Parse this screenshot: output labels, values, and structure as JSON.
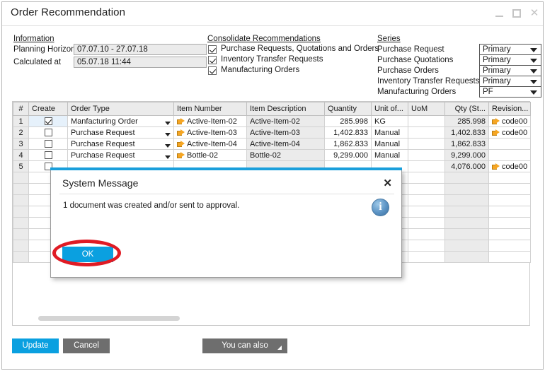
{
  "window": {
    "title": "Order Recommendation",
    "minimize_label": "minimize",
    "maximize_label": "maximize",
    "close_label": "close"
  },
  "information": {
    "group_title": "Information",
    "fields": [
      {
        "label": "Planning Horizon",
        "value": "07.07.10 - 27.07.18"
      },
      {
        "label": "Calculated at",
        "value": "05.07.18  11:44"
      }
    ]
  },
  "consolidate": {
    "group_title": "Consolidate Recommendations",
    "items": [
      {
        "label": "Purchase Requests, Quotations and Orders",
        "checked": true
      },
      {
        "label": "Inventory Transfer Requests",
        "checked": true
      },
      {
        "label": "Manufacturing Orders",
        "checked": true
      }
    ]
  },
  "series": {
    "group_title": "Series",
    "rows": [
      {
        "label": "Purchase Request",
        "value": "Primary"
      },
      {
        "label": "Purchase Quotations",
        "value": "Primary"
      },
      {
        "label": "Purchase Orders",
        "value": "Primary"
      },
      {
        "label": "Inventory Transfer Requests",
        "value": "Primary"
      },
      {
        "label": "Manufacturing Orders",
        "value": "PF"
      }
    ]
  },
  "grid": {
    "columns": [
      "#",
      "Create",
      "Order Type",
      "Item Number",
      "Item Description",
      "Quantity",
      "Unit of...",
      "UoM",
      "Qty (St...",
      "Revision..."
    ],
    "rows": [
      {
        "index": "1",
        "create": true,
        "order_type": "Manfacturing Order",
        "item_number": "Active-Item-02",
        "item_description": "Active-Item-02",
        "quantity": "285.998",
        "unit_of": "KG",
        "uom": "",
        "qty_st": "285.998",
        "revision": "code00",
        "selected": true
      },
      {
        "index": "2",
        "create": false,
        "order_type": "Purchase Request",
        "item_number": "Active-Item-03",
        "item_description": "Active-Item-03",
        "quantity": "1,402.833",
        "unit_of": "Manual",
        "uom": "",
        "qty_st": "1,402.833",
        "revision": "code00",
        "selected": false
      },
      {
        "index": "3",
        "create": false,
        "order_type": "Purchase Request",
        "item_number": "Active-Item-04",
        "item_description": "Active-Item-04",
        "quantity": "1,862.833",
        "unit_of": "Manual",
        "uom": "",
        "qty_st": "1,862.833",
        "revision": "",
        "selected": false
      },
      {
        "index": "4",
        "create": false,
        "order_type": "Purchase Request",
        "item_number": "Bottle-02",
        "item_description": "Bottle-02",
        "quantity": "9,299.000",
        "unit_of": "Manual",
        "uom": "",
        "qty_st": "9,299.000",
        "revision": "",
        "selected": false
      },
      {
        "index": "5",
        "create": false,
        "order_type": "",
        "item_number": "",
        "item_description": "",
        "quantity": "",
        "unit_of": "",
        "uom": "",
        "qty_st": "4,076.000",
        "revision": "code00",
        "selected": false
      }
    ],
    "empty_row_count": 8
  },
  "footer": {
    "update_label": "Update",
    "cancel_label": "Cancel",
    "you_can_also_label": "You can also"
  },
  "dialog": {
    "title": "System Message",
    "close_label": "✕",
    "message": "1 document was created and/or sent to approval.",
    "ok_label": "OK",
    "icon": "info-icon"
  },
  "colors": {
    "accent_blue": "#0aa0e0",
    "dialog_accent": "#1a9fdb",
    "gray_button": "#6e6e6e",
    "highlight_red": "#e01b24",
    "link_orange": "#f6a623"
  }
}
